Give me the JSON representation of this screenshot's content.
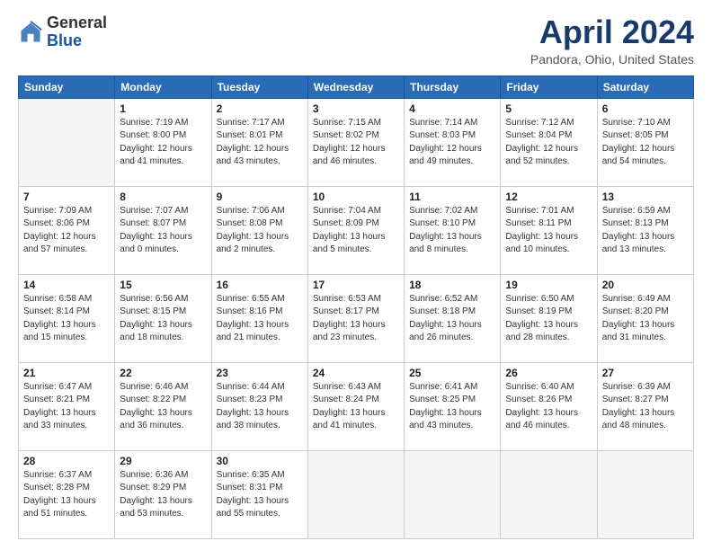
{
  "logo": {
    "general": "General",
    "blue": "Blue"
  },
  "header": {
    "month": "April 2024",
    "location": "Pandora, Ohio, United States"
  },
  "days_of_week": [
    "Sunday",
    "Monday",
    "Tuesday",
    "Wednesday",
    "Thursday",
    "Friday",
    "Saturday"
  ],
  "weeks": [
    [
      {
        "day": "",
        "info": ""
      },
      {
        "day": "1",
        "info": "Sunrise: 7:19 AM\nSunset: 8:00 PM\nDaylight: 12 hours\nand 41 minutes."
      },
      {
        "day": "2",
        "info": "Sunrise: 7:17 AM\nSunset: 8:01 PM\nDaylight: 12 hours\nand 43 minutes."
      },
      {
        "day": "3",
        "info": "Sunrise: 7:15 AM\nSunset: 8:02 PM\nDaylight: 12 hours\nand 46 minutes."
      },
      {
        "day": "4",
        "info": "Sunrise: 7:14 AM\nSunset: 8:03 PM\nDaylight: 12 hours\nand 49 minutes."
      },
      {
        "day": "5",
        "info": "Sunrise: 7:12 AM\nSunset: 8:04 PM\nDaylight: 12 hours\nand 52 minutes."
      },
      {
        "day": "6",
        "info": "Sunrise: 7:10 AM\nSunset: 8:05 PM\nDaylight: 12 hours\nand 54 minutes."
      }
    ],
    [
      {
        "day": "7",
        "info": "Sunrise: 7:09 AM\nSunset: 8:06 PM\nDaylight: 12 hours\nand 57 minutes."
      },
      {
        "day": "8",
        "info": "Sunrise: 7:07 AM\nSunset: 8:07 PM\nDaylight: 13 hours\nand 0 minutes."
      },
      {
        "day": "9",
        "info": "Sunrise: 7:06 AM\nSunset: 8:08 PM\nDaylight: 13 hours\nand 2 minutes."
      },
      {
        "day": "10",
        "info": "Sunrise: 7:04 AM\nSunset: 8:09 PM\nDaylight: 13 hours\nand 5 minutes."
      },
      {
        "day": "11",
        "info": "Sunrise: 7:02 AM\nSunset: 8:10 PM\nDaylight: 13 hours\nand 8 minutes."
      },
      {
        "day": "12",
        "info": "Sunrise: 7:01 AM\nSunset: 8:11 PM\nDaylight: 13 hours\nand 10 minutes."
      },
      {
        "day": "13",
        "info": "Sunrise: 6:59 AM\nSunset: 8:13 PM\nDaylight: 13 hours\nand 13 minutes."
      }
    ],
    [
      {
        "day": "14",
        "info": "Sunrise: 6:58 AM\nSunset: 8:14 PM\nDaylight: 13 hours\nand 15 minutes."
      },
      {
        "day": "15",
        "info": "Sunrise: 6:56 AM\nSunset: 8:15 PM\nDaylight: 13 hours\nand 18 minutes."
      },
      {
        "day": "16",
        "info": "Sunrise: 6:55 AM\nSunset: 8:16 PM\nDaylight: 13 hours\nand 21 minutes."
      },
      {
        "day": "17",
        "info": "Sunrise: 6:53 AM\nSunset: 8:17 PM\nDaylight: 13 hours\nand 23 minutes."
      },
      {
        "day": "18",
        "info": "Sunrise: 6:52 AM\nSunset: 8:18 PM\nDaylight: 13 hours\nand 26 minutes."
      },
      {
        "day": "19",
        "info": "Sunrise: 6:50 AM\nSunset: 8:19 PM\nDaylight: 13 hours\nand 28 minutes."
      },
      {
        "day": "20",
        "info": "Sunrise: 6:49 AM\nSunset: 8:20 PM\nDaylight: 13 hours\nand 31 minutes."
      }
    ],
    [
      {
        "day": "21",
        "info": "Sunrise: 6:47 AM\nSunset: 8:21 PM\nDaylight: 13 hours\nand 33 minutes."
      },
      {
        "day": "22",
        "info": "Sunrise: 6:46 AM\nSunset: 8:22 PM\nDaylight: 13 hours\nand 36 minutes."
      },
      {
        "day": "23",
        "info": "Sunrise: 6:44 AM\nSunset: 8:23 PM\nDaylight: 13 hours\nand 38 minutes."
      },
      {
        "day": "24",
        "info": "Sunrise: 6:43 AM\nSunset: 8:24 PM\nDaylight: 13 hours\nand 41 minutes."
      },
      {
        "day": "25",
        "info": "Sunrise: 6:41 AM\nSunset: 8:25 PM\nDaylight: 13 hours\nand 43 minutes."
      },
      {
        "day": "26",
        "info": "Sunrise: 6:40 AM\nSunset: 8:26 PM\nDaylight: 13 hours\nand 46 minutes."
      },
      {
        "day": "27",
        "info": "Sunrise: 6:39 AM\nSunset: 8:27 PM\nDaylight: 13 hours\nand 48 minutes."
      }
    ],
    [
      {
        "day": "28",
        "info": "Sunrise: 6:37 AM\nSunset: 8:28 PM\nDaylight: 13 hours\nand 51 minutes."
      },
      {
        "day": "29",
        "info": "Sunrise: 6:36 AM\nSunset: 8:29 PM\nDaylight: 13 hours\nand 53 minutes."
      },
      {
        "day": "30",
        "info": "Sunrise: 6:35 AM\nSunset: 8:31 PM\nDaylight: 13 hours\nand 55 minutes."
      },
      {
        "day": "",
        "info": ""
      },
      {
        "day": "",
        "info": ""
      },
      {
        "day": "",
        "info": ""
      },
      {
        "day": "",
        "info": ""
      }
    ]
  ]
}
